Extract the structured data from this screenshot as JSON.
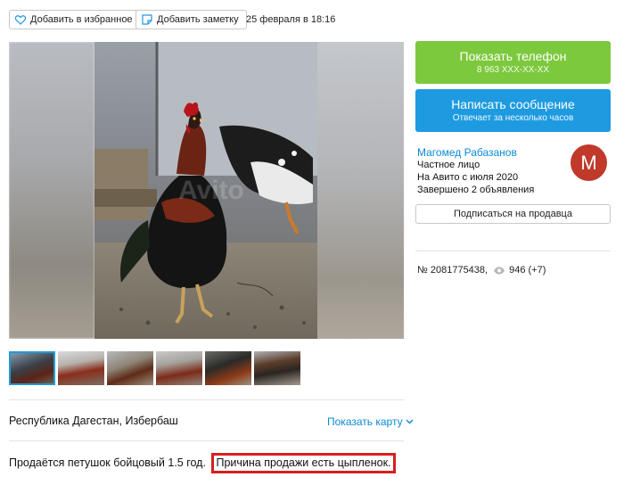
{
  "toolbar": {
    "favorite_label": "Добавить в избранное",
    "note_label": "Добавить заметку",
    "date": "25 февраля в 18:16"
  },
  "gallery": {
    "watermark": "Avito",
    "thumbnail_count": 6,
    "active_thumbnail": 1
  },
  "location": {
    "address": "Республика Дагестан, Избербаш",
    "map_link": "Показать карту"
  },
  "description": {
    "text": "Продаётся петушок бойцовый 1.5 год.",
    "highlighted": "Причина продажи есть цыпленок."
  },
  "contact": {
    "call_label": "Показать телефон",
    "phone_masked": "8 963 XXX-XX-XX",
    "message_label": "Написать сообщение",
    "message_sub": "Отвечает за несколько часов"
  },
  "seller": {
    "name": "Магомед Рабазанов",
    "type": "Частное лицо",
    "since": "На Авито с июля 2020",
    "completed": "Завершено 2 объявления",
    "avatar_letter": "М",
    "subscribe_label": "Подписаться на продавца"
  },
  "stats": {
    "ad_number": "№ 2081775438,",
    "views": "946 (+7)"
  },
  "colors": {
    "call": "#7cc93d",
    "message": "#1e9be0",
    "link": "#0a8ad6",
    "highlight_border": "#d61f1f",
    "avatar": "#c0392b"
  }
}
